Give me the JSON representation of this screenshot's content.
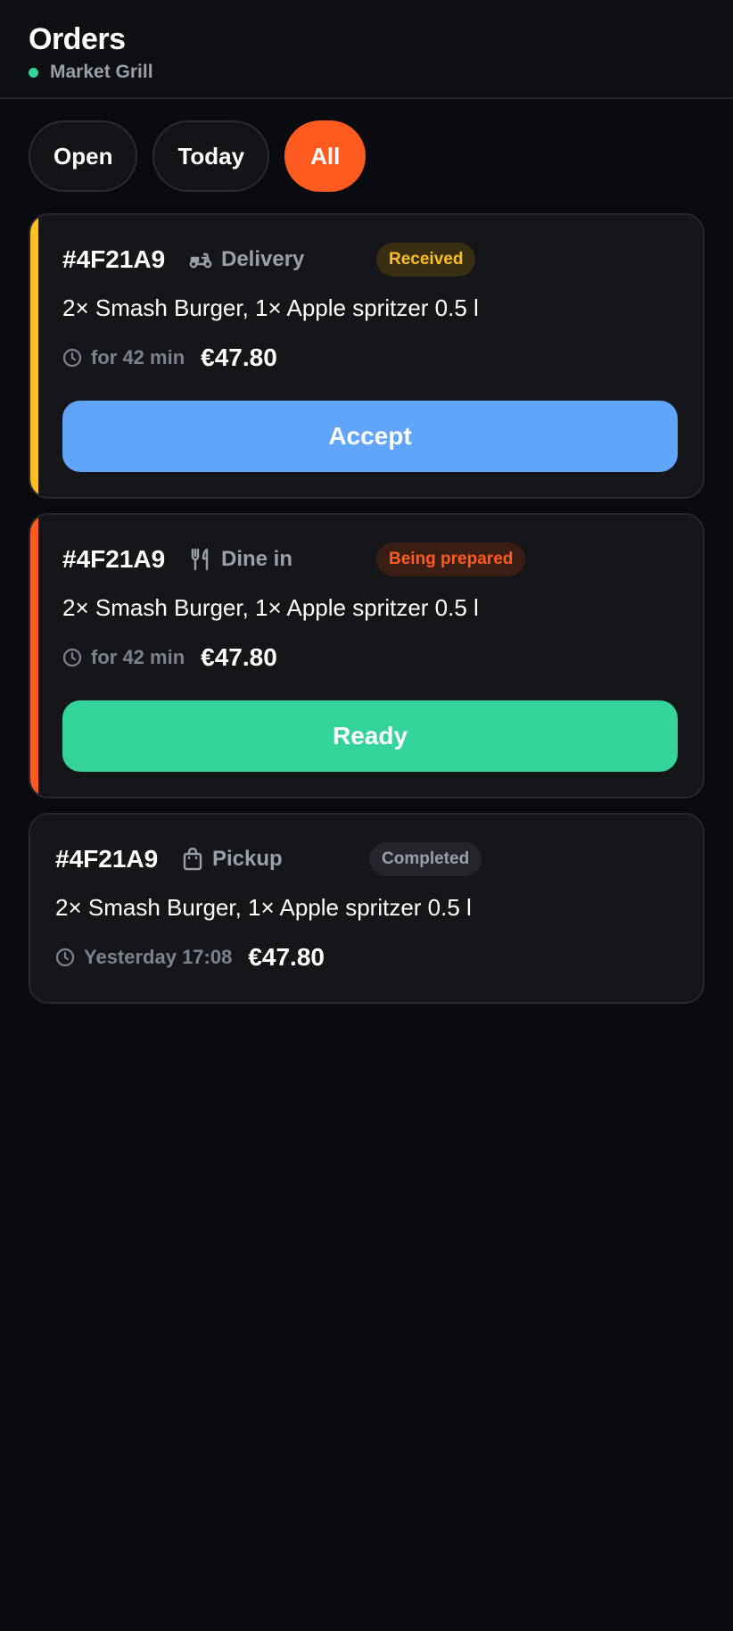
{
  "header": {
    "title": "Orders",
    "restaurant": "Market Grill",
    "status_color": "#34d399"
  },
  "filters": [
    {
      "label": "Open",
      "active": false
    },
    {
      "label": "Today",
      "active": false
    },
    {
      "label": "All",
      "active": true
    }
  ],
  "accent_color": "#ff5a1f",
  "orders": [
    {
      "id": "#4F21A9",
      "type": "Delivery",
      "type_icon": "scooter-icon",
      "status": "Received",
      "status_color": "#fbbf24",
      "items": "2× Smash Burger, 1× Apple spritzer 0.5 l",
      "time": "for 42 min",
      "price": "€47.80",
      "action": "Accept",
      "action_color": "#60a5fa"
    },
    {
      "id": "#4F21A9",
      "type": "Dine in",
      "type_icon": "cutlery-icon",
      "status": "Being prepared",
      "status_color": "#ff5a1f",
      "items": "2× Smash Burger, 1× Apple spritzer 0.5 l",
      "time": "for 42 min",
      "price": "€47.80",
      "action": "Ready",
      "action_color": "#34d399"
    },
    {
      "id": "#4F21A9",
      "type": "Pickup",
      "type_icon": "shopping-bag-icon",
      "status": "Completed",
      "status_color": "#9aa0a8",
      "items": "2× Smash Burger, 1× Apple spritzer 0.5 l",
      "time": "Yesterday 17:08",
      "price": "€47.80"
    }
  ]
}
